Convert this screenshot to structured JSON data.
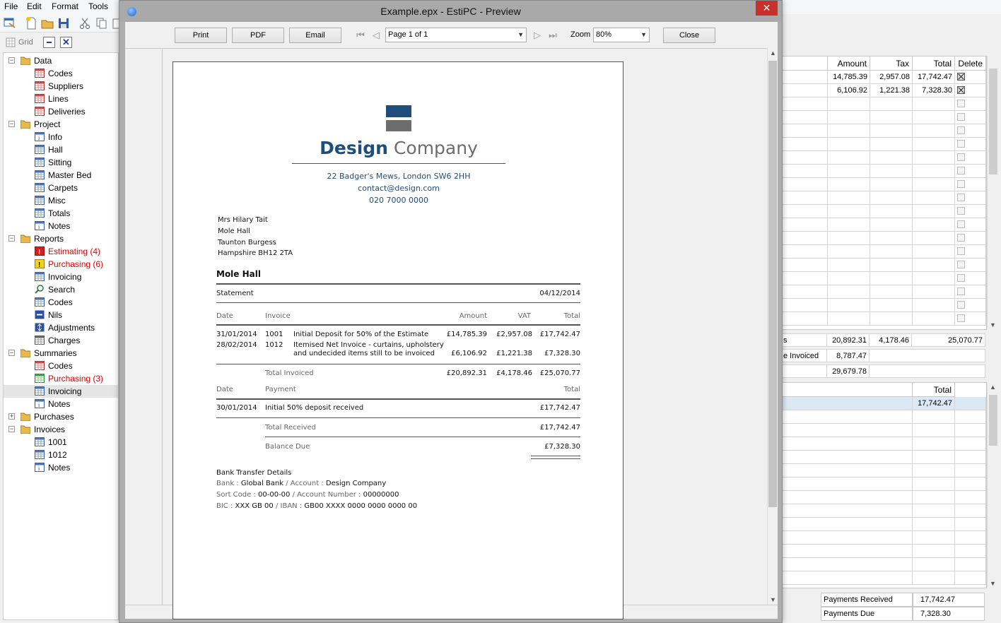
{
  "menu": {
    "file": "File",
    "edit": "Edit",
    "format": "Format",
    "tools": "Tools"
  },
  "gridbar": {
    "grid_label": "Grid"
  },
  "tree": [
    {
      "label": "Data",
      "type": "folder",
      "exp": "-"
    },
    {
      "label": "Codes",
      "type": "grid-red"
    },
    {
      "label": "Suppliers",
      "type": "grid-red"
    },
    {
      "label": "Lines",
      "type": "grid-red"
    },
    {
      "label": "Deliveries",
      "type": "grid-red"
    },
    {
      "label": "Project",
      "type": "folder",
      "exp": "-"
    },
    {
      "label": "Info",
      "type": "info"
    },
    {
      "label": "Hall",
      "type": "grid-blue"
    },
    {
      "label": "Sitting",
      "type": "grid-blue"
    },
    {
      "label": "Master Bed",
      "type": "grid-blue"
    },
    {
      "label": "Carpets",
      "type": "grid-blue"
    },
    {
      "label": "Misc",
      "type": "grid-blue"
    },
    {
      "label": "Totals",
      "type": "grid-blue"
    },
    {
      "label": "Notes",
      "type": "info"
    },
    {
      "label": "Reports",
      "type": "folder",
      "exp": "-"
    },
    {
      "label": "Estimating (4)",
      "type": "warn-red",
      "red": true
    },
    {
      "label": "Purchasing (6)",
      "type": "warn-yellow",
      "red": true
    },
    {
      "label": "Invoicing",
      "type": "grid-blue"
    },
    {
      "label": "Search",
      "type": "search"
    },
    {
      "label": "Codes",
      "type": "grid-blue"
    },
    {
      "label": "Nils",
      "type": "nils"
    },
    {
      "label": "Adjustments",
      "type": "adjust"
    },
    {
      "label": "Charges",
      "type": "grid-grey"
    },
    {
      "label": "Summaries",
      "type": "folder",
      "exp": "-"
    },
    {
      "label": "Codes",
      "type": "grid-red"
    },
    {
      "label": "Purchasing (3)",
      "type": "grid-green",
      "red": true
    },
    {
      "label": "Invoicing",
      "type": "grid-blue",
      "selected": true
    },
    {
      "label": "Notes",
      "type": "info"
    },
    {
      "label": "Purchases",
      "type": "folder",
      "exp": "+"
    },
    {
      "label": "Invoices",
      "type": "folder",
      "exp": "-"
    },
    {
      "label": "1001",
      "type": "grid-blue"
    },
    {
      "label": "1012",
      "type": "grid-blue"
    },
    {
      "label": "Notes",
      "type": "info"
    }
  ],
  "right_grid": {
    "headers": [
      "Amount",
      "Tax",
      "Total",
      "Delete"
    ],
    "rows": [
      {
        "amount": "14,785.39",
        "tax": "2,957.08",
        "total": "17,742.47",
        "deletable": true
      },
      {
        "amount": "6,106.92",
        "tax": "1,221.38",
        "total": "7,328.30",
        "deletable": true
      }
    ],
    "empty_rows": 17,
    "totals": [
      {
        "label": "s",
        "amount": "20,892.31",
        "tax": "4,178.46",
        "total": "25,070.77"
      },
      {
        "label": "e Invoiced",
        "amount": "8,787.47",
        "tax": "",
        "total": ""
      },
      {
        "label": "",
        "amount": "29,679.78",
        "tax": "",
        "total": ""
      }
    ]
  },
  "payments_grid": {
    "header": "Total",
    "rows": [
      {
        "total": "17,742.47"
      }
    ],
    "empty_rows": 13,
    "summary": [
      {
        "label": "Payments Received",
        "value": "17,742.47"
      },
      {
        "label": "Payments Due",
        "value": "7,328.30"
      }
    ]
  },
  "preview": {
    "title": "Example.epx - EstiPC - Preview",
    "close_x": "✕",
    "buttons": {
      "print": "Print",
      "pdf": "PDF",
      "email": "Email",
      "close": "Close"
    },
    "page_select": "Page 1 of 1",
    "zoom_label": "Zoom",
    "zoom_value": "80%"
  },
  "document": {
    "brand_bold": "Design",
    "brand_light": "Company",
    "address": "22 Badger's Mews, London SW6 2HH",
    "email": "contact@design.com",
    "phone": "020 7000 0000",
    "recipient": [
      "Mrs Hilary Tait",
      "Mole Hall",
      "Taunton Burgess",
      "Hampshire BH12 2TA"
    ],
    "project": "Mole Hall",
    "statement_label": "Statement",
    "statement_date": "04/12/2014",
    "inv_headers": {
      "date": "Date",
      "invoice": "Invoice",
      "amount": "Amount",
      "vat": "VAT",
      "total": "Total"
    },
    "invoices": [
      {
        "date": "31/01/2014",
        "no": "1001",
        "desc1": "Initial Deposit for 50% of the Estimate",
        "desc2": "",
        "amount": "£14,785.39",
        "vat": "£2,957.08",
        "total": "£17,742.47"
      },
      {
        "date": "28/02/2014",
        "no": "1012",
        "desc1": "Itemised Net Invoice - curtains, upholstery",
        "desc2": "and undecided items still to be invoiced",
        "amount": "£6,106.92",
        "vat": "£1,221.38",
        "total": "£7,328.30"
      }
    ],
    "total_invoiced": {
      "label": "Total Invoiced",
      "amount": "£20,892.31",
      "vat": "£4,178.46",
      "total": "£25,070.77"
    },
    "pay_headers": {
      "date": "Date",
      "payment": "Payment",
      "total": "Total"
    },
    "payments": [
      {
        "date": "30/01/2014",
        "desc": "Initial 50% deposit received",
        "total": "£17,742.47"
      }
    ],
    "total_received": {
      "label": "Total Received",
      "total": "£17,742.47"
    },
    "balance_due": {
      "label": "Balance Due",
      "total": "£7,328.30"
    },
    "bank": {
      "heading": "Bank Transfer Details",
      "bank_label": "Bank : ",
      "bank_value": "Global Bank",
      "account_label": " / Account : ",
      "account_value": "Design Company",
      "sort_label": "Sort Code : ",
      "sort_value": "00-00-00",
      "accno_label": " / Account Number : ",
      "accno_value": "00000000",
      "bic_label": "BIC : ",
      "bic_value": "XXX GB 00",
      "iban_label": " / IBAN : ",
      "iban_value": "GB00 XXXX 0000 0000 0000 00"
    }
  },
  "colors": {
    "brand_blue": "#1f4e7a",
    "brand_grey": "#6d6d6d",
    "close_red": "#c7302b",
    "error_red": "#e00000"
  }
}
